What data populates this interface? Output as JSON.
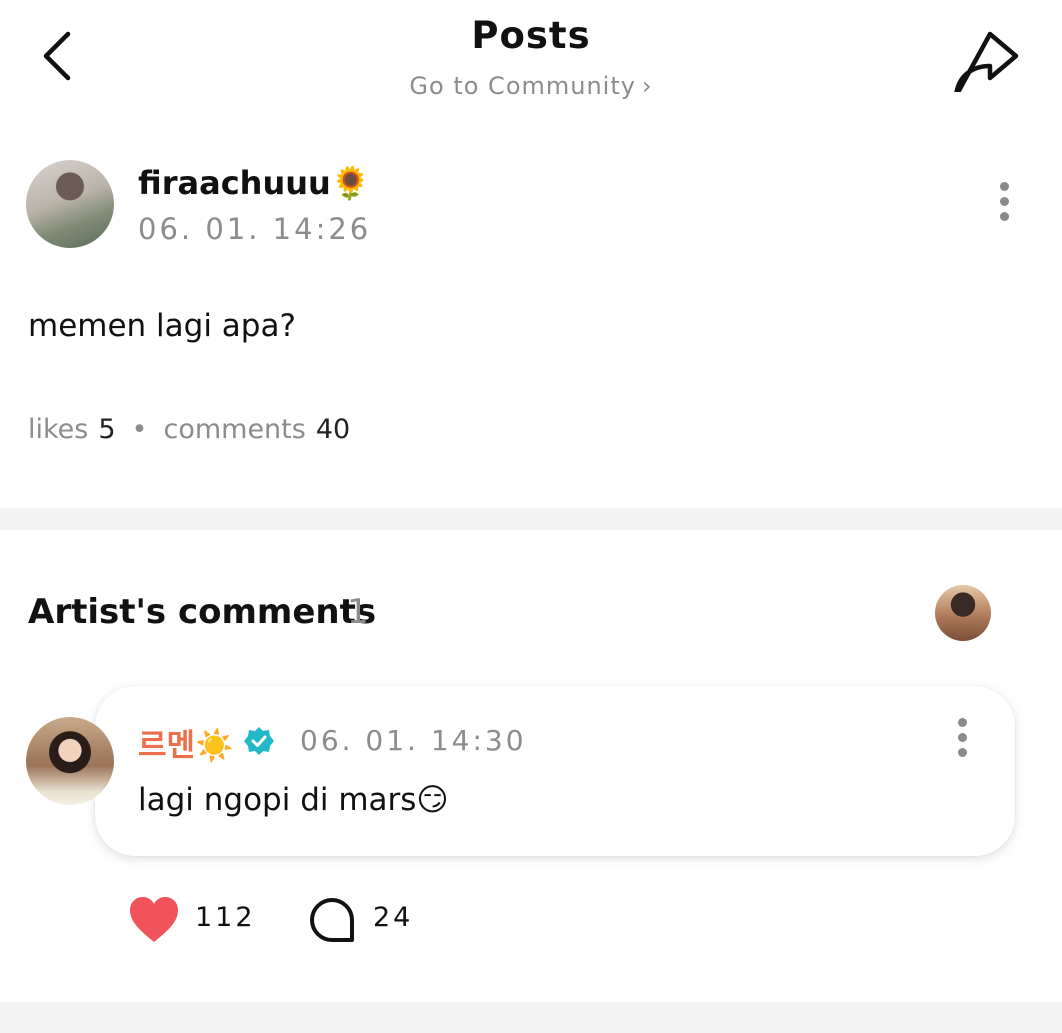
{
  "header": {
    "title": "Posts",
    "subtitle": "Go to Community",
    "subtitle_chevron": "›",
    "back_icon": "chevron-left-icon",
    "share_icon": "share-arrow-icon"
  },
  "post": {
    "author": "firaachuuu🌻",
    "timestamp": "06. 01. 14:26",
    "body": "memen lagi apa?",
    "likes_label": "likes",
    "likes_count": "5",
    "separator": "•",
    "comments_label": "comments",
    "comments_count": "40"
  },
  "artist_comments": {
    "title": "Artist's comments",
    "count": "1",
    "comment": {
      "author": "르멘☀️",
      "verified_icon": "verified-badge-icon",
      "timestamp": "06. 01. 14:30",
      "text": "lagi ngopi di mars😏",
      "likes": "112",
      "replies": "24"
    }
  },
  "colors": {
    "artist_name": "#e9704a",
    "verified": "#22b8c8",
    "heart": "#f1535a",
    "muted_text": "#8c8c8c",
    "divider": "#f4f4f4"
  }
}
